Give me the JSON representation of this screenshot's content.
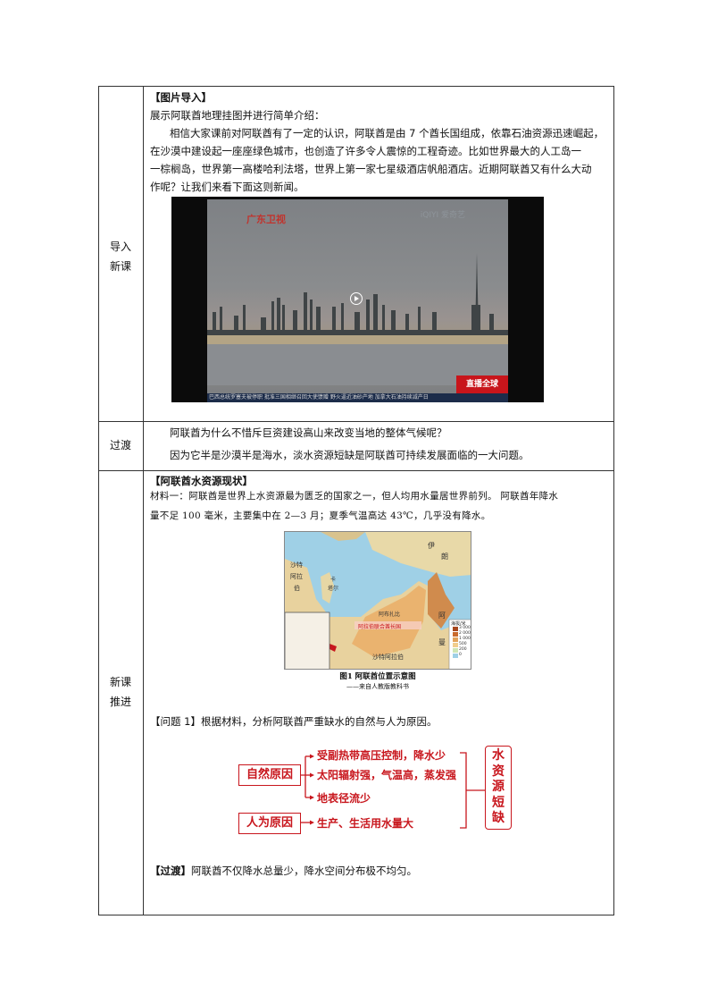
{
  "rows": {
    "intro_label_1": "导入",
    "intro_label_2": "新课",
    "transition_label": "过渡",
    "new_label_1": "新课",
    "new_label_2": "推进"
  },
  "intro": {
    "heading": "【图片导入】",
    "line1": "展示阿联酋地理挂图并进行简单介绍：",
    "para1": "相信大家课前对阿联酋有了一定的认识，阿联酋是由 7 个酋长国组成，依靠石油资源迅速崛起，",
    "para2": "在沙漠中建设起一座座绿色城市，也创造了许多令人震惊的工程奇迹。比如世界最大的人工岛一",
    "para3": "一棕榈岛，世界第一高楼哈利法塔，世界上第一家七星级酒店帆船酒店。近期阿联酋又有什么大动",
    "para4": "作呢？让我们来看下面这则新闻。"
  },
  "video": {
    "logo_left": "广东卫视",
    "logo_right": "iQIYI 爱奇艺",
    "ticker": "巴西总统罗塞夫被停职   批准三国相继召回大使馈赠   野火逼近油砂产地   加拿大石油持续减产日",
    "badge": "直播全球"
  },
  "transition": {
    "line1": "阿联酋为什么不惜斥巨资建设高山来改变当地的整体气候呢？",
    "line2": "因为它半是沙漠半是海水，淡水资源短缺是阿联酋可持续发展面临的一大问题。"
  },
  "water": {
    "heading": "【阿联酋水资源现状】",
    "material1": "材料一：阿联酋是世界上水资源最为匮乏的国家之一，但人均用水量居世界前列。 阿联酋年降水",
    "material2": "量不足 100 毫米，主要集中在 2—3 月；夏季气温高达 43℃，几乎没有降水。",
    "map_caption": "图1   阿联酋位置示意图",
    "map_source": "——来自人教版教科书",
    "map_labels": [
      "伊",
      "朗",
      "沙特",
      "阿拉",
      "伯",
      "卡",
      "塔尔",
      "阿布扎比",
      "阿",
      "曼",
      "沙特阿拉伯",
      "阿拉伯联合酋长国"
    ],
    "legend_title": "海拔/米",
    "legend_values": [
      "3 000",
      "2 000",
      "1 000",
      "500",
      "200",
      "0"
    ],
    "question": "【问题 1】根据材料，分析阿联酋严重缺水的自然与人为原因。",
    "natural": "自然原因",
    "human": "人为原因",
    "causes": [
      "受副热带高压控制，降水少",
      "太阳辐射强，气温高，蒸发强",
      "地表径流少"
    ],
    "human_cause": "生产、生活用水量大",
    "result_chars": [
      "水",
      "资",
      "源",
      "短",
      "缺"
    ],
    "transition_bold": "【过渡】",
    "transition_text": "阿联酋不仅降水总量少，降水空间分布极不均匀。"
  },
  "colors": {
    "accent_red": "#c8161d"
  }
}
